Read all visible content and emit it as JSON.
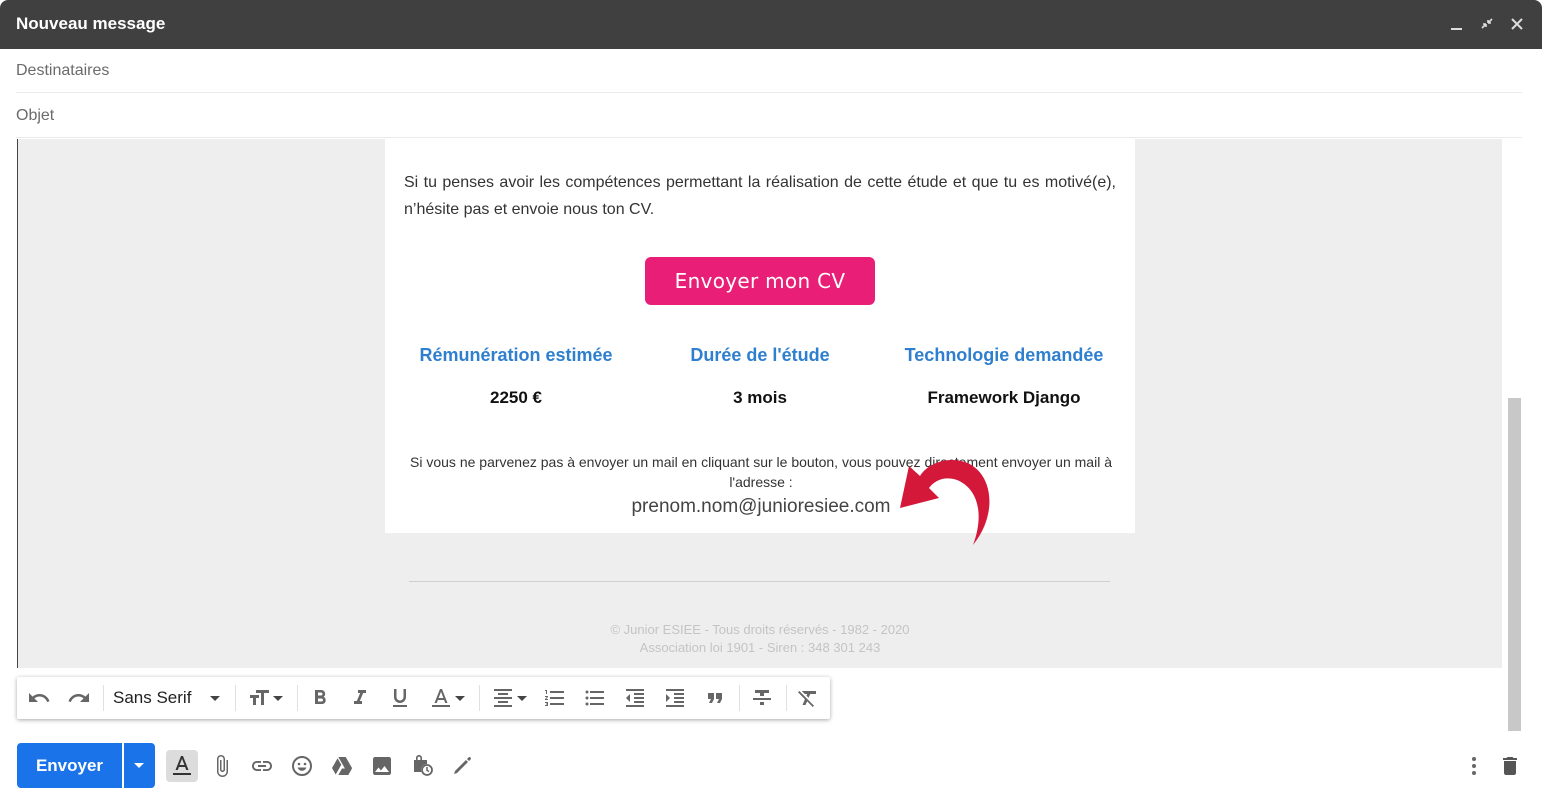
{
  "window": {
    "title": "Nouveau message"
  },
  "fields": {
    "to_label": "Destinataires",
    "subject_label": "Objet"
  },
  "email": {
    "paragraph": "Si tu penses avoir les compétences permettant la réalisation de cette étude et que tu es motivé(e), n’hésite pas et envoie nous ton CV.",
    "cta_label": "Envoyer mon CV",
    "columns": [
      {
        "heading": "Rémunération estimée",
        "value": "2250 €"
      },
      {
        "heading": "Durée de l'étude",
        "value": "3 mois"
      },
      {
        "heading": "Technologie demandée",
        "value": "Framework Django"
      }
    ],
    "note": "Si vous ne parvenez pas à envoyer un mail en cliquant sur le bouton, vous pouvez directement envoyer un mail à l'adresse :",
    "address": "prenom.nom@junioresiee.com",
    "footer_line1": "© Junior ESIEE - Tous droits réservés - 1982 - 2020",
    "footer_line2": "Association loi 1901 - Siren : 348 301 243",
    "cta_color": "#e91e77",
    "heading_color": "#2f7fcf"
  },
  "toolbar": {
    "font_name": "Sans Serif"
  },
  "actions": {
    "send_label": "Envoyer",
    "send_color": "#1a73e8"
  },
  "icons": [
    "undo-icon",
    "redo-icon",
    "text-size-icon",
    "bold-icon",
    "italic-icon",
    "underline-icon",
    "text-color-icon",
    "align-icon",
    "numbered-list-icon",
    "bulleted-list-icon",
    "indent-less-icon",
    "indent-more-icon",
    "quote-icon",
    "strikethrough-icon",
    "remove-formatting-icon",
    "formatting-options-icon",
    "attach-icon",
    "link-icon",
    "emoji-icon",
    "drive-icon",
    "photo-icon",
    "confidential-icon",
    "signature-icon",
    "more-options-icon",
    "trash-icon"
  ]
}
